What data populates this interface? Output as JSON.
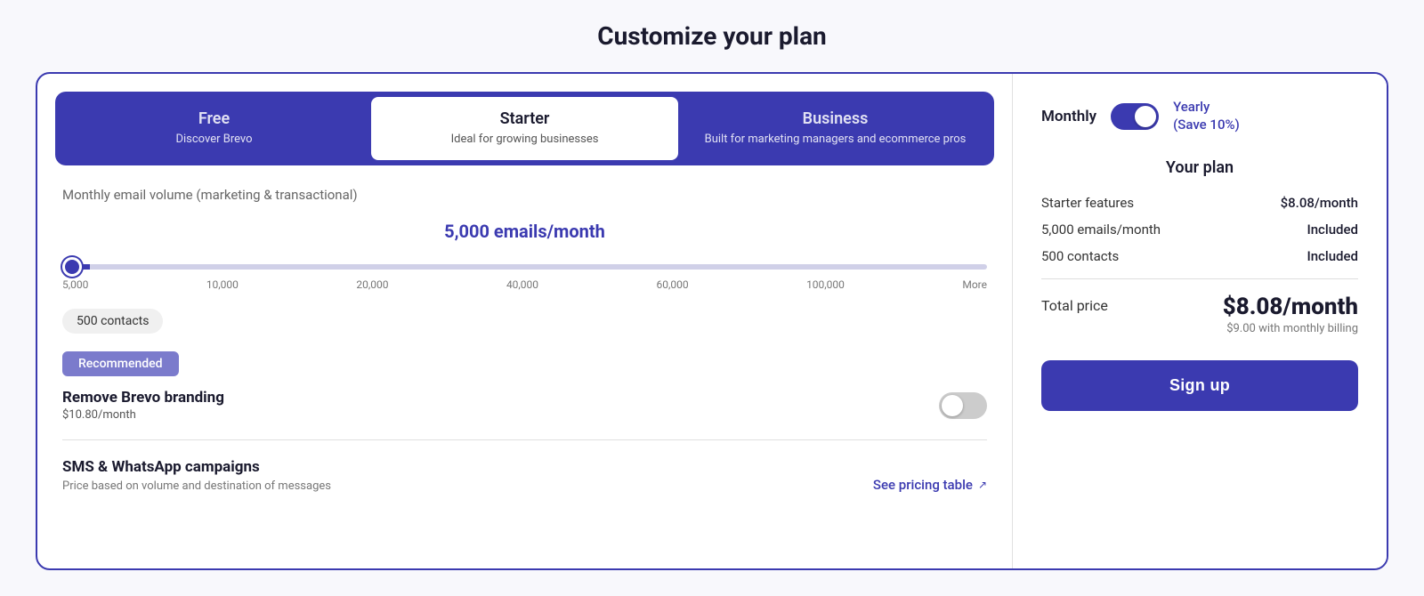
{
  "page": {
    "title": "Customize your plan"
  },
  "plans": [
    {
      "id": "free",
      "name": "Free",
      "description": "Discover Brevo",
      "active": false
    },
    {
      "id": "starter",
      "name": "Starter",
      "description": "Ideal for growing businesses",
      "active": true
    },
    {
      "id": "business",
      "name": "Business",
      "description": "Built for marketing managers and ecommerce pros",
      "active": false
    }
  ],
  "volume": {
    "label": "Monthly email volume",
    "sublabel": "(marketing & transactional)",
    "current_value": "5,000 emails/month",
    "slider_min": 5000,
    "slider_max": 100000,
    "slider_value": 5000,
    "labels": [
      "5,000",
      "10,000",
      "20,000",
      "40,000",
      "60,000",
      "100,000",
      "More"
    ]
  },
  "contacts": {
    "label": "500 contacts"
  },
  "addon": {
    "badge": "Recommended",
    "name": "Remove Brevo branding",
    "price": "$10.80/month",
    "enabled": false
  },
  "sms": {
    "title": "SMS & WhatsApp campaigns",
    "description": "Price based on volume and destination of messages",
    "see_pricing_label": "See pricing table",
    "see_pricing_icon": "↗"
  },
  "billing": {
    "monthly_label": "Monthly",
    "yearly_label": "Yearly",
    "yearly_save": "(Save 10%)",
    "yearly_active": true
  },
  "your_plan": {
    "title": "Your plan",
    "lines": [
      {
        "label": "Starter features",
        "value": "$8.08/month"
      },
      {
        "label": "5,000 emails/month",
        "value": "Included"
      },
      {
        "label": "500 contacts",
        "value": "Included"
      }
    ],
    "total_label": "Total price",
    "total_main": "$8.08/month",
    "total_sub": "$9.00 with monthly billing",
    "signup_label": "Sign up"
  }
}
